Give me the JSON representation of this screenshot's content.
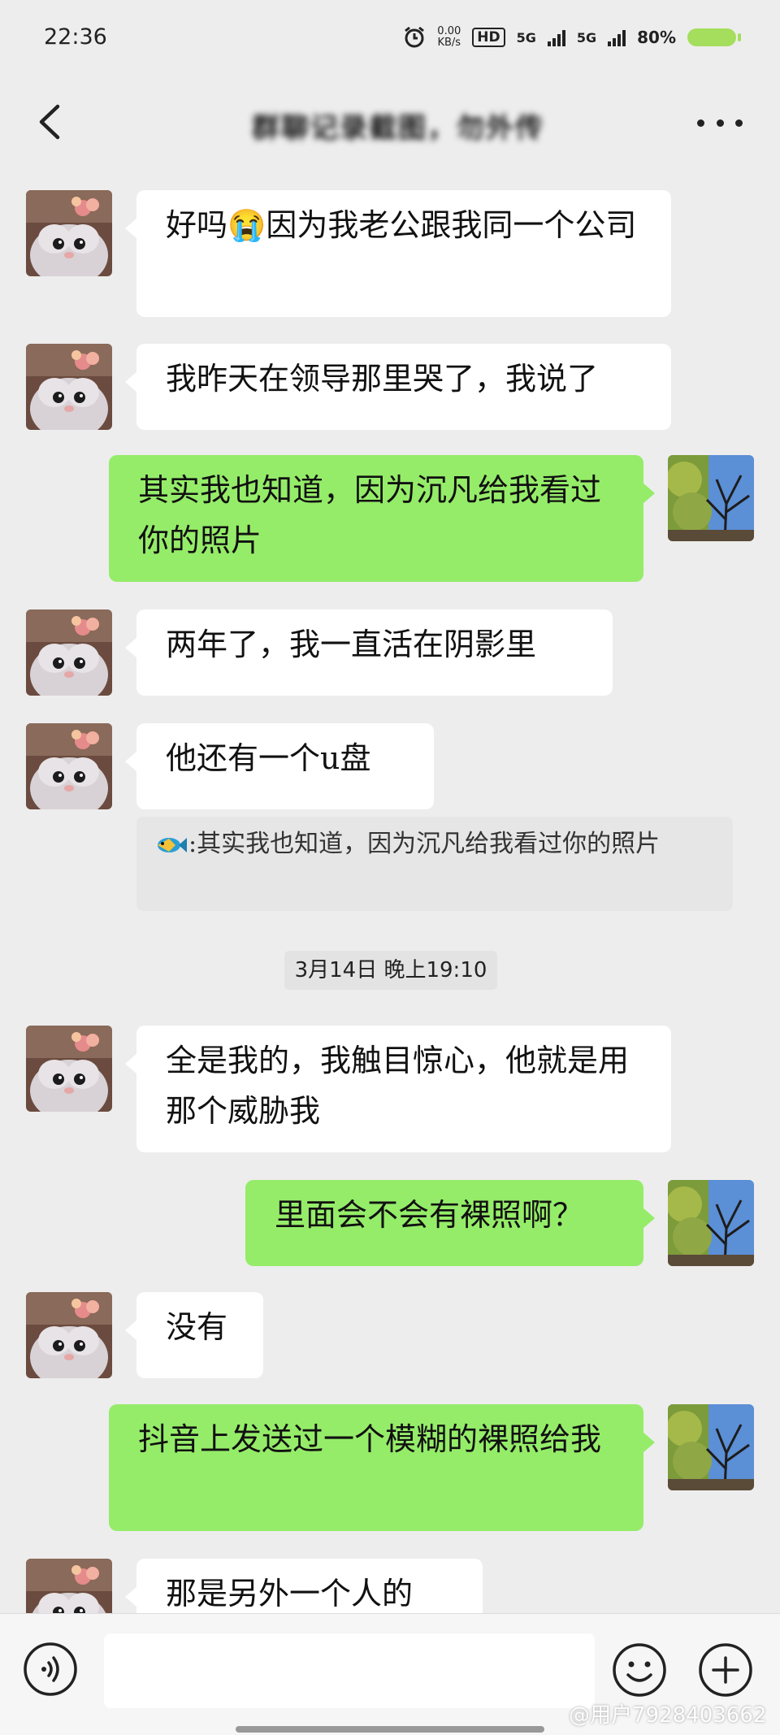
{
  "status_bar": {
    "time": "22:36",
    "net_speed_top": "0.00",
    "net_speed_unit": "KB/s",
    "hd": "HD",
    "signal1": "5G",
    "signal2": "5G",
    "battery": "80%"
  },
  "header": {
    "title": "群聊记录截图，勿外传"
  },
  "messages": [
    {
      "side": "in",
      "text": "好吗😭因为我老公跟我同一个公司"
    },
    {
      "side": "in",
      "text": "我昨天在领导那里哭了，我说了"
    },
    {
      "side": "out",
      "text": "其实我也知道，因为沉凡给我看过你的照片"
    },
    {
      "side": "in",
      "text": "两年了，我一直活在阴影里"
    },
    {
      "side": "in",
      "text": "他还有一个u盘"
    },
    {
      "side": "in",
      "text": "全是我的，我触目惊心，他就是用那个威胁我"
    },
    {
      "side": "out",
      "text": "里面会不会有裸照啊？"
    },
    {
      "side": "in",
      "text": "没有"
    },
    {
      "side": "out",
      "text": "抖音上发送过一个模糊的裸照给我"
    },
    {
      "side": "in",
      "text": "那是另外一个人的"
    }
  ],
  "quote": {
    "text": ":其实我也知道，因为沉凡给我看过你的照片"
  },
  "timestamp": "3月14日 晚上19:10",
  "input": {
    "placeholder": ""
  },
  "watermark": "@用户7928403662",
  "icons": {
    "back": "back-icon",
    "more": "more-icon",
    "voice": "voice-icon",
    "emoji": "emoji-icon",
    "plus": "plus-icon"
  }
}
